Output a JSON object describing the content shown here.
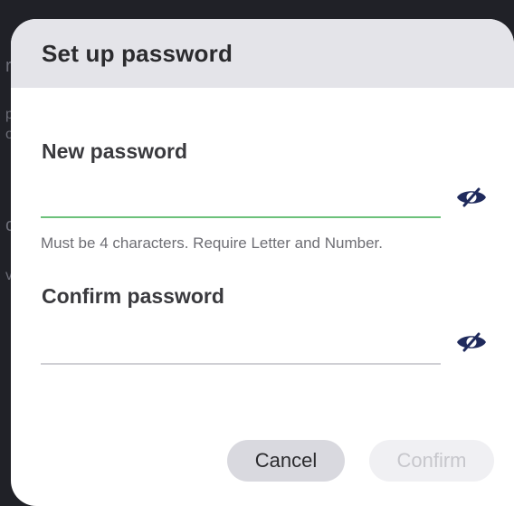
{
  "dialog": {
    "title": "Set up password",
    "new_password": {
      "label": "New password",
      "value": "",
      "helper": "Must be 4 characters. Require Letter and Number."
    },
    "confirm_password": {
      "label": "Confirm password",
      "value": ""
    },
    "buttons": {
      "cancel": "Cancel",
      "confirm": "Confirm"
    }
  },
  "icons": {
    "visibility_toggle": "eye-slash-icon"
  },
  "colors": {
    "header_bg": "#e4e4e9",
    "active_underline": "#6cc17a",
    "inactive_underline": "#cfcfd4",
    "eye_icon": "#1f2a5c",
    "cancel_bg": "#d9d9df",
    "confirm_bg": "#f0f0f3",
    "confirm_text_disabled": "#c7c7cc"
  }
}
